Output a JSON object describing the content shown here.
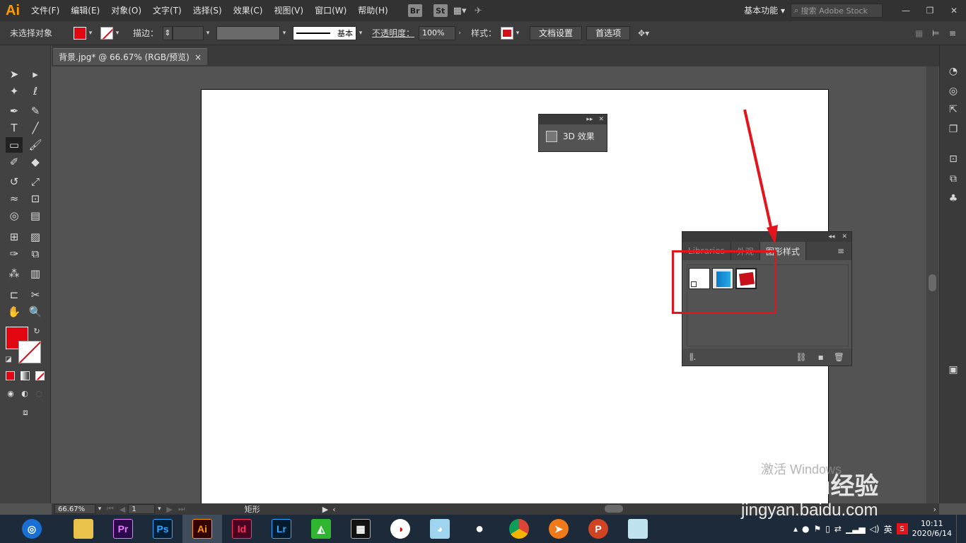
{
  "app": {
    "logo": "Ai"
  },
  "menu": [
    "文件(F)",
    "编辑(E)",
    "对象(O)",
    "文字(T)",
    "选择(S)",
    "效果(C)",
    "视图(V)",
    "窗口(W)",
    "帮助(H)"
  ],
  "bridge": [
    "Br",
    "St"
  ],
  "workspace": "基本功能",
  "search": {
    "placeholder": "搜索 Adobe Stock"
  },
  "control": {
    "selection": "未选择对象",
    "stroke_label": "描边：",
    "stroke_style": "基本",
    "opacity_label": "不透明度：",
    "opacity_value": "100%",
    "style_label": "样式：",
    "doc_setup": "文档设置",
    "preferences": "首选项",
    "fill_color": "#e30613"
  },
  "document": {
    "tab_title": "背景.jpg* @ 66.67% (RGB/预览)",
    "close": "×"
  },
  "panel3d": {
    "title": "3D 效果"
  },
  "graphic_styles": {
    "tabs": [
      "Libraries",
      "外观",
      "图形样式"
    ],
    "active_tab": "图形样式",
    "swatches": [
      "default-style",
      "blue-3d-cube",
      "red-3d-shape"
    ]
  },
  "status": {
    "zoom": "66.67%",
    "page": "1",
    "tool": "矩形"
  },
  "taskbar": {
    "apps": [
      {
        "name": "Pr",
        "color": "#2a0a4a",
        "fg": "#e77cff"
      },
      {
        "name": "Ps",
        "color": "#001e36",
        "fg": "#31a8ff"
      },
      {
        "name": "Ai",
        "color": "#330000",
        "fg": "#ff9a00"
      },
      {
        "name": "Id",
        "color": "#49021f",
        "fg": "#ff3366"
      },
      {
        "name": "Lr",
        "color": "#001a2e",
        "fg": "#31a8ff"
      }
    ],
    "time": "10:11",
    "date": "2020/6/14",
    "ime": "英"
  },
  "watermark": {
    "line1": "激活 Windows",
    "brand": "Baidu经验",
    "url": "jingyan.baidu.com"
  }
}
